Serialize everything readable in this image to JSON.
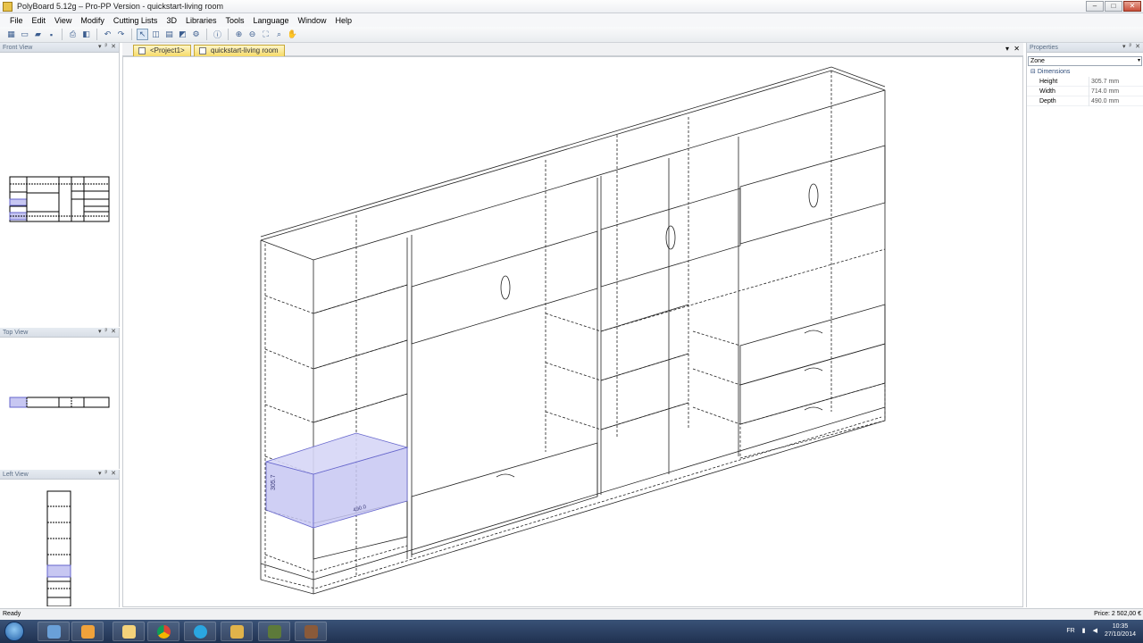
{
  "window": {
    "title": "PolyBoard 5.12g – Pro-PP Version - quickstart-living room",
    "minimize": "–",
    "maximize": "□",
    "close": "✕"
  },
  "menu": [
    "File",
    "Edit",
    "View",
    "Modify",
    "Cutting Lists",
    "3D",
    "Libraries",
    "Tools",
    "Language",
    "Window",
    "Help"
  ],
  "panels": {
    "front_view": {
      "title": "Front View"
    },
    "top_view": {
      "title": "Top View"
    },
    "left_view": {
      "title": "Left View"
    },
    "controls": {
      "dropdown": "▾",
      "pin": "ᵖ",
      "close": "✕"
    }
  },
  "tabs": [
    {
      "label": "<Project1>"
    },
    {
      "label": "quickstart-living room"
    }
  ],
  "viewport": {
    "tab_menu": "▾",
    "tab_close": "✕",
    "dimension_label": "305.7",
    "dimension_label_2": "490.0"
  },
  "properties": {
    "title": "Properties",
    "selected": "Zone",
    "section": "Dimensions",
    "rows": [
      {
        "key": "Height",
        "value": "305.7 mm"
      },
      {
        "key": "Width",
        "value": "714.0 mm"
      },
      {
        "key": "Depth",
        "value": "490.0 mm"
      }
    ]
  },
  "status": {
    "left": "Ready",
    "right": "Price: 2 502,00 €"
  },
  "taskbar": {
    "language": "FR",
    "time": "10:35",
    "date": "27/10/2014",
    "apps": [
      "media-icon",
      "folder-icon",
      "chrome-icon",
      "skype-icon",
      "polyboard-icon",
      "cad-icon",
      "app-icon"
    ]
  },
  "colors": {
    "selection_fill": "#c7c7f2",
    "selection_stroke": "#6666cc",
    "accent_tab": "#f6db68"
  }
}
